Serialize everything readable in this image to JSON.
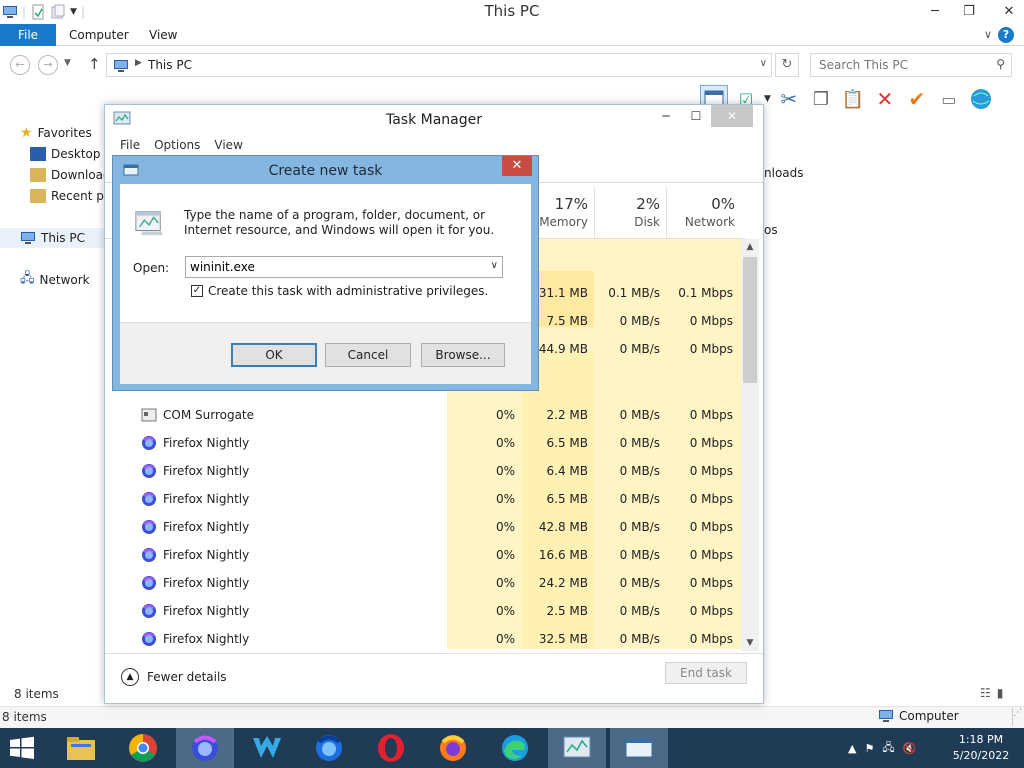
{
  "explorer": {
    "title": "This PC",
    "ribbon_tabs": [
      "File",
      "Computer",
      "View"
    ],
    "address_path": "This PC",
    "search_placeholder": "Search This PC",
    "nav": {
      "favorites": "Favorites",
      "desktop": "Desktop",
      "downloads": "Download",
      "recent": "Recent pla",
      "this_pc": "This PC",
      "network": "Network"
    },
    "content_snippets": [
      "nloads",
      "os"
    ],
    "status_items": "8 items",
    "status_items_bottom": "8 items",
    "status_computer": "Computer"
  },
  "taskmgr": {
    "title": "Task Manager",
    "menu": [
      "File",
      "Options",
      "View"
    ],
    "columns": {
      "memory": {
        "pct": "17%",
        "name": "Memory"
      },
      "disk": {
        "pct": "2%",
        "name": "Disk"
      },
      "network": {
        "pct": "0%",
        "name": "Network"
      }
    },
    "top_rows": [
      {
        "memory": "131.1 MB",
        "disk": "0.1 MB/s",
        "network": "0.1 Mbps"
      },
      {
        "memory": "7.5 MB",
        "disk": "0 MB/s",
        "network": "0 Mbps"
      },
      {
        "memory": "44.9 MB",
        "disk": "0 MB/s",
        "network": "0 Mbps"
      }
    ],
    "processes": [
      {
        "name": "COM Surrogate",
        "cpu": "0%",
        "memory": "2.2 MB",
        "disk": "0 MB/s",
        "network": "0 Mbps",
        "icon": "com-surrogate-icon"
      },
      {
        "name": "Firefox Nightly",
        "cpu": "0%",
        "memory": "6.5 MB",
        "disk": "0 MB/s",
        "network": "0 Mbps",
        "icon": "firefox-nightly-icon"
      },
      {
        "name": "Firefox Nightly",
        "cpu": "0%",
        "memory": "6.4 MB",
        "disk": "0 MB/s",
        "network": "0 Mbps",
        "icon": "firefox-nightly-icon"
      },
      {
        "name": "Firefox Nightly",
        "cpu": "0%",
        "memory": "6.5 MB",
        "disk": "0 MB/s",
        "network": "0 Mbps",
        "icon": "firefox-nightly-icon"
      },
      {
        "name": "Firefox Nightly",
        "cpu": "0%",
        "memory": "42.8 MB",
        "disk": "0 MB/s",
        "network": "0 Mbps",
        "icon": "firefox-nightly-icon"
      },
      {
        "name": "Firefox Nightly",
        "cpu": "0%",
        "memory": "16.6 MB",
        "disk": "0 MB/s",
        "network": "0 Mbps",
        "icon": "firefox-nightly-icon"
      },
      {
        "name": "Firefox Nightly",
        "cpu": "0%",
        "memory": "24.2 MB",
        "disk": "0 MB/s",
        "network": "0 Mbps",
        "icon": "firefox-nightly-icon"
      },
      {
        "name": "Firefox Nightly",
        "cpu": "0%",
        "memory": "2.5 MB",
        "disk": "0 MB/s",
        "network": "0 Mbps",
        "icon": "firefox-nightly-icon"
      },
      {
        "name": "Firefox Nightly",
        "cpu": "0%",
        "memory": "32.5 MB",
        "disk": "0 MB/s",
        "network": "0 Mbps",
        "icon": "firefox-nightly-icon"
      }
    ],
    "fewer_details": "Fewer details",
    "end_task": "End task"
  },
  "runbox": {
    "title": "Create new task",
    "description": "Type the name of a program, folder, document, or Internet resource, and Windows will open it for you.",
    "open_label": "Open:",
    "open_value": "wininit.exe",
    "admin_label": "Create this task with administrative privileges.",
    "admin_checked": true,
    "ok": "OK",
    "cancel": "Cancel",
    "browse": "Browse..."
  },
  "taskbar": {
    "apps": [
      "file-explorer-icon",
      "chrome-icon",
      "firefox-nightly-icon",
      "waterfox-icon",
      "firefox-dev-icon",
      "opera-icon",
      "firefox-icon",
      "edge-icon",
      "task-manager-icon",
      "run-dialog-icon"
    ],
    "time": "1:18 PM",
    "date": "5/20/2022"
  },
  "colors": {
    "accent": "#1979ca",
    "taskbar": "#1f3b55",
    "dialog_frame": "#85b6e0",
    "close_red": "#c94c44",
    "heat_light": "#fff4c4"
  }
}
